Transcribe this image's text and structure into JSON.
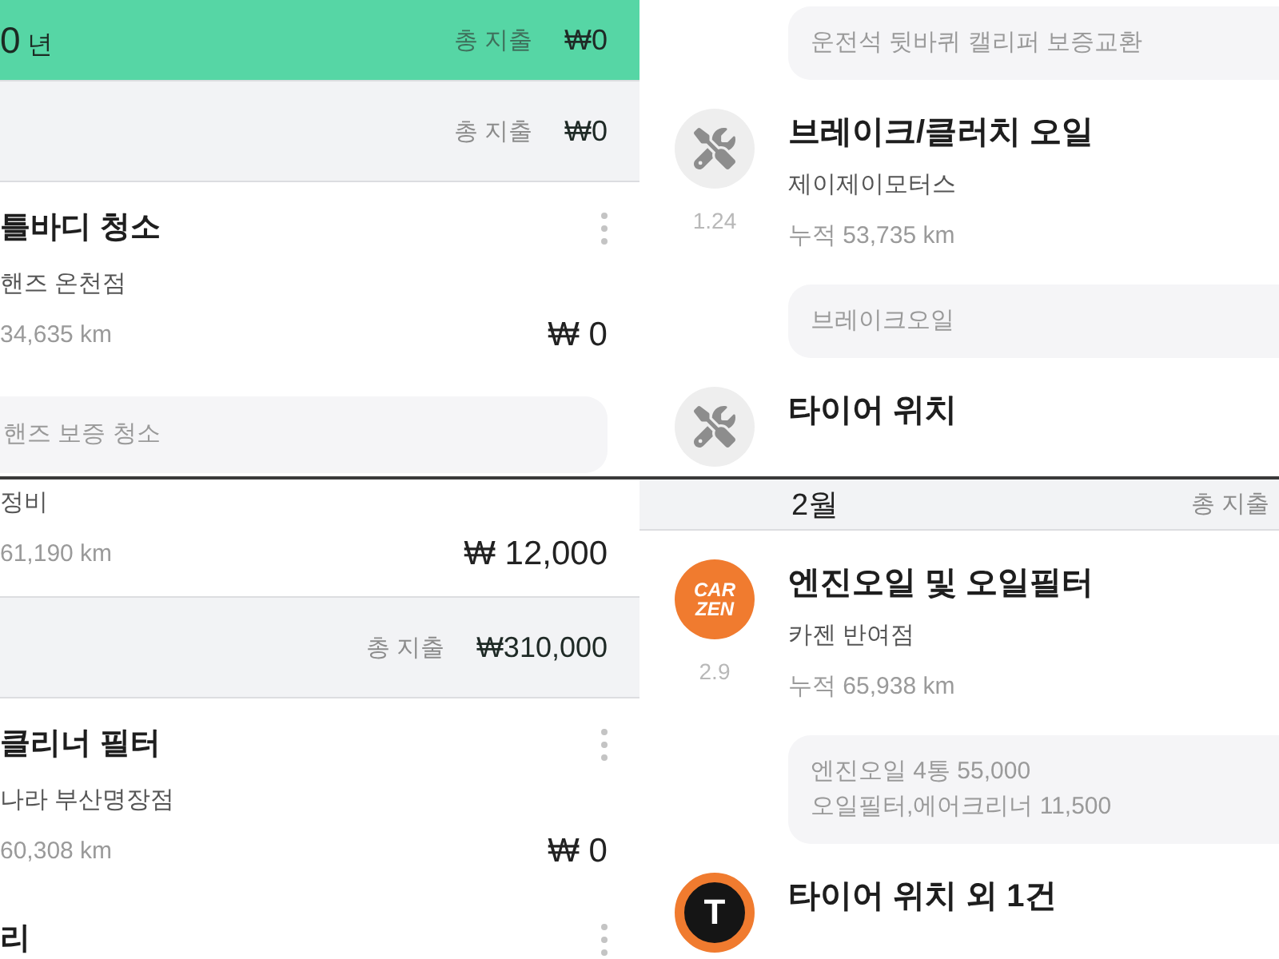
{
  "panels": [
    {
      "rows": [
        {
          "kind": "year_header",
          "year": "0",
          "unit": "년",
          "total_label": "총 지출",
          "total": "₩0"
        },
        {
          "kind": "month_header",
          "total_label": "총 지출",
          "total": "₩0"
        },
        {
          "kind": "record",
          "title": "틀바디 청소",
          "menu": true,
          "shop": "핸즈 온천점",
          "mileage": "34,635 km",
          "amount": "₩ 0"
        },
        {
          "kind": "memo",
          "lines": [
            "핸즈 보증 청소"
          ]
        }
      ]
    },
    {
      "rows": [
        {
          "kind": "memo",
          "lines": [
            "운전석 뒷바퀴 캘리퍼 보증교환"
          ]
        },
        {
          "kind": "record",
          "badge": {
            "kind": "tools"
          },
          "date": "1.24",
          "title": "브레이크/클러치 오일",
          "shop": "제이제이모터스",
          "mileage": "누적 53,735 km"
        },
        {
          "kind": "memo",
          "lines": [
            "브레이크오일"
          ]
        },
        {
          "kind": "record",
          "badge": {
            "kind": "tools"
          },
          "title": "타이어 위치"
        }
      ]
    },
    {
      "rows": [
        {
          "kind": "record",
          "shop": "정비",
          "mileage": "61,190 km",
          "amount": "₩ 12,000"
        },
        {
          "kind": "month_header",
          "total_label": "총 지출",
          "total": "₩310,000"
        },
        {
          "kind": "record",
          "title": "클리너 필터",
          "menu": true,
          "shop": "나라 부산명장점",
          "mileage": "60,308 km",
          "amount": "₩ 0"
        },
        {
          "kind": "record",
          "title": "리",
          "menu": true
        }
      ]
    },
    {
      "rows": [
        {
          "kind": "month_header",
          "month": "2월",
          "total_label": "총 지출"
        },
        {
          "kind": "record",
          "badge": {
            "kind": "logo",
            "text": "CAR ZEN"
          },
          "date": "2.9",
          "title": "엔진오일 및 오일필터",
          "shop": "카젠 반여점",
          "mileage": "누적 65,938 km"
        },
        {
          "kind": "memo",
          "lines": [
            "엔진오일 4통 55,000",
            "오일필터,에어크리너 11,500"
          ]
        },
        {
          "kind": "record",
          "badge": {
            "kind": "letter_logo",
            "text": "T"
          },
          "title": "타이어 위치 외 1건"
        }
      ]
    }
  ]
}
